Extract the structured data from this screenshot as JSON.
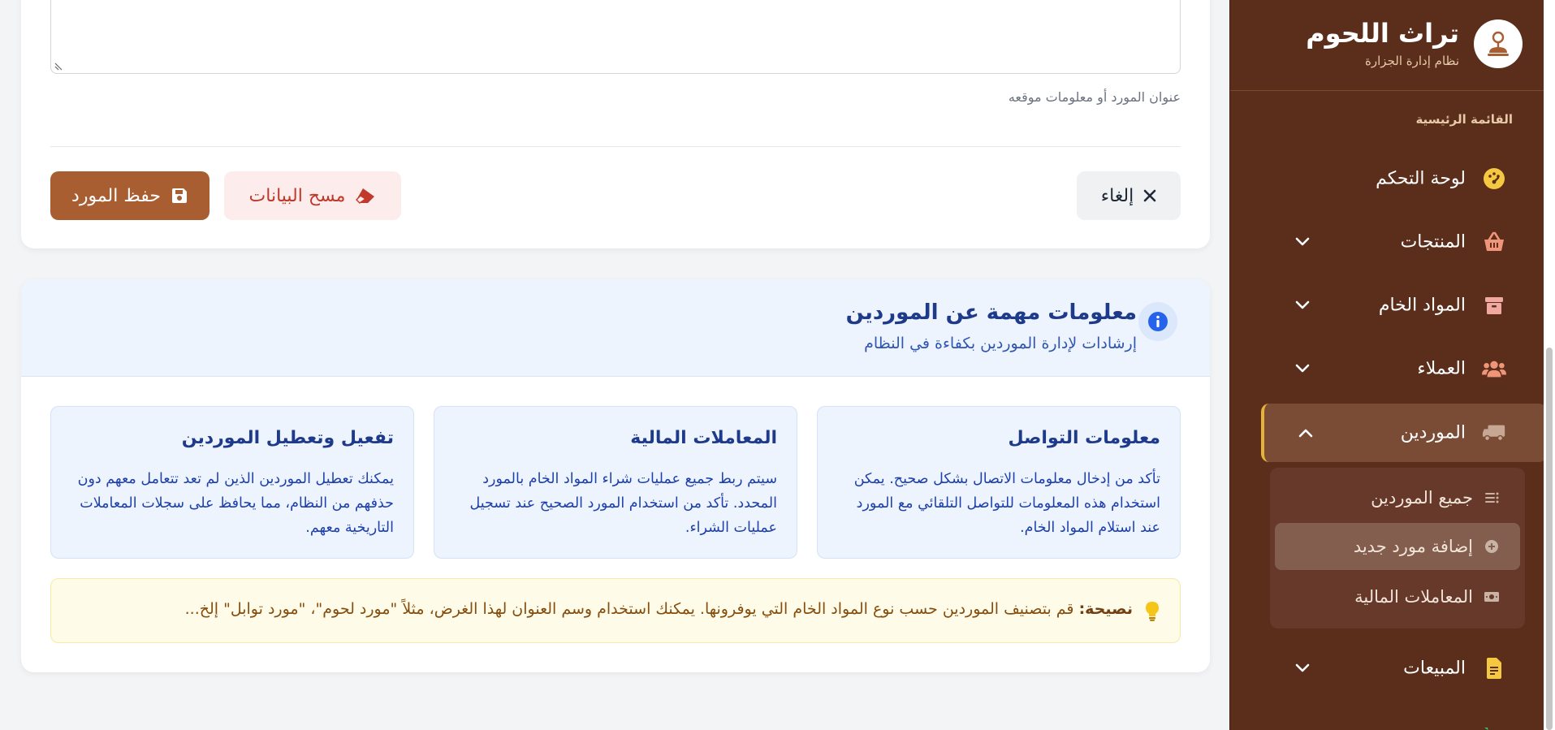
{
  "brand": {
    "title": "تراث اللحوم",
    "subtitle": "نظام إدارة الجزارة"
  },
  "sidebar": {
    "section_label": "القائمة الرئيسية",
    "items": [
      {
        "label": "لوحة التحكم",
        "icon": "dashboard-icon",
        "icon_color": "#f5c842"
      },
      {
        "label": "المنتجات",
        "icon": "basket-icon",
        "icon_color": "#f0957a"
      },
      {
        "label": "المواد الخام",
        "icon": "box-icon",
        "icon_color": "#f0a8a0"
      },
      {
        "label": "العملاء",
        "icon": "users-icon",
        "icon_color": "#f0957a"
      },
      {
        "label": "الموردين",
        "icon": "truck-icon",
        "icon_color": "#c7a693"
      },
      {
        "label": "المبيعات",
        "icon": "invoice-icon",
        "icon_color": "#f5c842"
      }
    ],
    "suppliers_submenu": [
      {
        "label": "جميع الموردين",
        "icon": "list-icon"
      },
      {
        "label": "إضافة مورد جديد",
        "icon": "plus-circle-icon"
      },
      {
        "label": "المعاملات المالية",
        "icon": "money-icon"
      }
    ],
    "colors": {
      "background": "#5a2e1b",
      "active_accent": "#e6b23a"
    }
  },
  "form": {
    "address_help": "عنوان المورد أو معلومات موقعه",
    "cancel_label": "إلغاء",
    "clear_label": "مسح البيانات",
    "save_label": "حفظ المورد",
    "colors": {
      "save": "#a95e32",
      "clear_text": "#c0392b",
      "clear_bg": "#fdecec"
    }
  },
  "info": {
    "title": "معلومات مهمة عن الموردين",
    "subtitle": "إرشادات لإدارة الموردين بكفاءة في النظام",
    "boxes": [
      {
        "title": "معلومات التواصل",
        "body": "تأكد من إدخال معلومات الاتصال بشكل صحيح. يمكن استخدام هذه المعلومات للتواصل التلقائي مع المورد عند استلام المواد الخام."
      },
      {
        "title": "المعاملات المالية",
        "body": "سيتم ربط جميع عمليات شراء المواد الخام بالمورد المحدد. تأكد من استخدام المورد الصحيح عند تسجيل عمليات الشراء."
      },
      {
        "title": "تفعيل وتعطيل الموردين",
        "body": "يمكنك تعطيل الموردين الذين لم تعد تتعامل معهم دون حذفهم من النظام، مما يحافظ على سجلات المعاملات التاريخية معهم."
      }
    ],
    "tip_label": "نصيحة:",
    "tip_text": "قم بتصنيف الموردين حسب نوع المواد الخام التي يوفرونها. يمكنك استخدام وسم العنوان لهذا الغرض، مثلاً \"مورد لحوم\"، \"مورد توابل\" إلخ...",
    "colors": {
      "header_bg": "#eef4fd",
      "title": "#1e3a8a",
      "tip_bg": "#fefbe8"
    }
  }
}
